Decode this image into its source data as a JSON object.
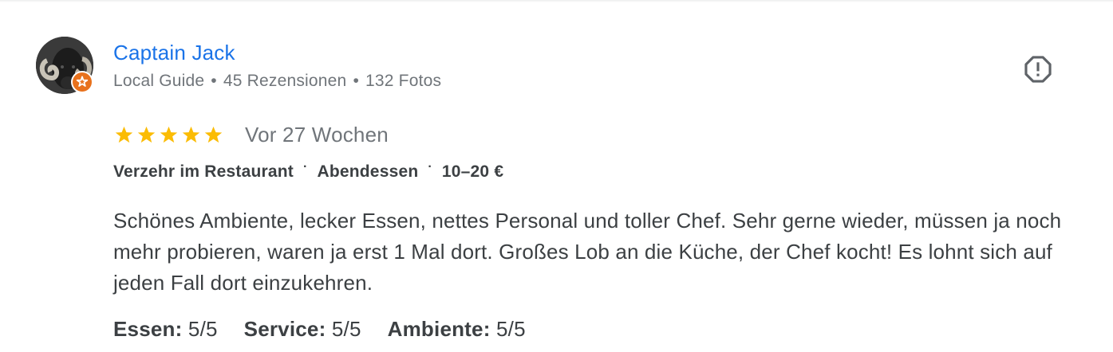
{
  "review": {
    "author": "Captain Jack",
    "author_meta": {
      "guide": "Local Guide",
      "separator": "•",
      "reviews": "45 Rezensionen",
      "photos": "132 Fotos"
    },
    "rating": 5,
    "rating_max": 5,
    "time": "Vor 27 Wochen",
    "tags": [
      "Verzehr im Restaurant",
      "Abendessen",
      "10–20 €"
    ],
    "tag_separator": "·",
    "text": "Schönes Ambiente, lecker Essen, nettes Personal und toller Chef. Sehr gerne wieder, müssen ja noch mehr probieren, waren ja erst 1 Mal dort. Großes Lob an die Küche, der Chef kocht! Es lohnt sich auf jeden Fall dort einzukehren.",
    "subratings": [
      {
        "label": "Essen:",
        "value": "5/5"
      },
      {
        "label": "Service:",
        "value": "5/5"
      },
      {
        "label": "Ambiente:",
        "value": "5/5"
      }
    ]
  },
  "icons": {
    "avatar": "ram-photo-avatar",
    "badge": "local-guide-star-icon",
    "report": "report-icon",
    "star": "star-icon"
  },
  "colors": {
    "author_link": "#1a73e8",
    "star": "#fbbc04",
    "badge": "#e8711c",
    "muted_text": "#70757a",
    "body_text": "#3c4043"
  }
}
